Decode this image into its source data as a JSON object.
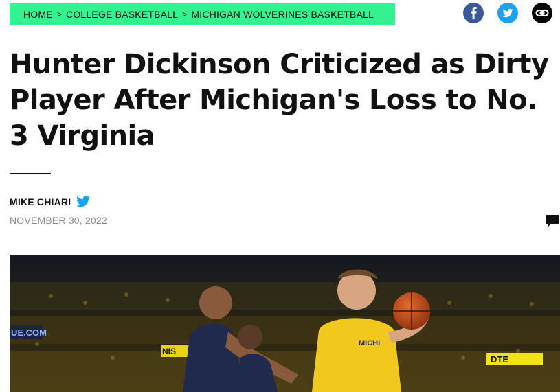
{
  "breadcrumb": {
    "items": [
      "HOME",
      "COLLEGE BASKETBALL",
      "MICHIGAN WOLVERINES BASKETBALL"
    ],
    "separator": ">"
  },
  "share": {
    "icons": [
      "facebook-icon",
      "twitter-icon",
      "link-icon"
    ]
  },
  "article": {
    "title": "Hunter Dickinson Criticized as Dirty Player After Michigan's Loss to No. 3 Virginia",
    "author": "MIKE CHIARI",
    "date": "NOVEMBER 30, 2022"
  },
  "hero": {
    "signs": {
      "left": "UE.COM",
      "mid": "NIS",
      "right": "DTE"
    },
    "jersey": "MICHI"
  },
  "colors": {
    "breadcrumb_bg": "#33f28f",
    "facebook": "#3b5998",
    "twitter": "#1da1f2",
    "michigan_maize": "#f2c81f",
    "virginia_navy": "#1f2a4d"
  }
}
